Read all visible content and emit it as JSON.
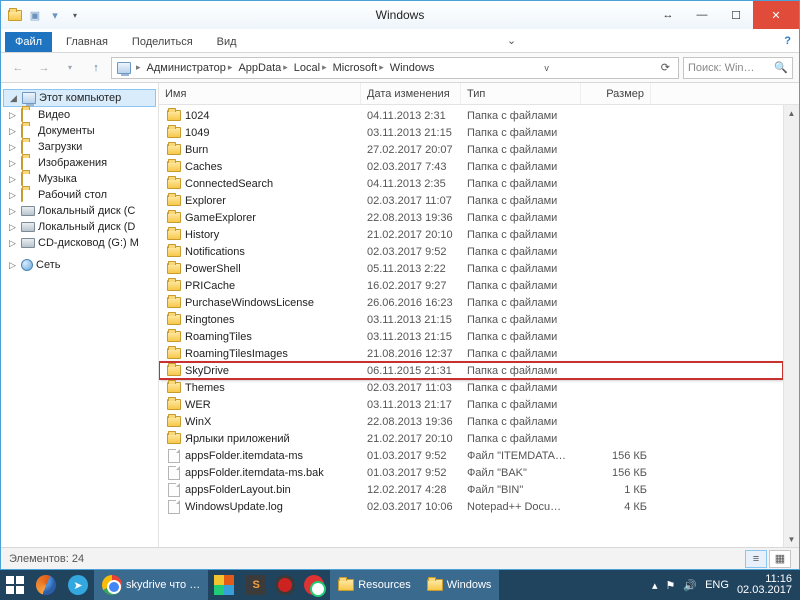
{
  "title": "Windows",
  "ribbon": {
    "file": "Файл",
    "home": "Главная",
    "share": "Поделиться",
    "view": "Вид"
  },
  "breadcrumb": [
    "Администратор",
    "AppData",
    "Local",
    "Microsoft",
    "Windows"
  ],
  "search": {
    "placeholder": "Поиск: Win…"
  },
  "columns": {
    "name": "Имя",
    "date": "Дата изменения",
    "type": "Тип",
    "size": "Размер"
  },
  "nav": {
    "root": "Этот компьютер",
    "items": [
      "Видео",
      "Документы",
      "Загрузки",
      "Изображения",
      "Музыка",
      "Рабочий стол",
      "Локальный диск (C",
      "Локальный диск (D",
      "CD-дисковод (G:) M"
    ],
    "network": "Сеть"
  },
  "folder_type": "Папка с файлами",
  "entries": [
    {
      "icon": "folder",
      "name": "1024",
      "date": "04.11.2013 2:31",
      "type": "Папка с файлами",
      "size": ""
    },
    {
      "icon": "folder",
      "name": "1049",
      "date": "03.11.2013 21:15",
      "type": "Папка с файлами",
      "size": ""
    },
    {
      "icon": "folder",
      "name": "Burn",
      "date": "27.02.2017 20:07",
      "type": "Папка с файлами",
      "size": ""
    },
    {
      "icon": "folder",
      "name": "Caches",
      "date": "02.03.2017 7:43",
      "type": "Папка с файлами",
      "size": ""
    },
    {
      "icon": "folder",
      "name": "ConnectedSearch",
      "date": "04.11.2013 2:35",
      "type": "Папка с файлами",
      "size": ""
    },
    {
      "icon": "folder",
      "name": "Explorer",
      "date": "02.03.2017 11:07",
      "type": "Папка с файлами",
      "size": ""
    },
    {
      "icon": "folder",
      "name": "GameExplorer",
      "date": "22.08.2013 19:36",
      "type": "Папка с файлами",
      "size": ""
    },
    {
      "icon": "folder",
      "name": "History",
      "date": "21.02.2017 20:10",
      "type": "Папка с файлами",
      "size": ""
    },
    {
      "icon": "folder",
      "name": "Notifications",
      "date": "02.03.2017 9:52",
      "type": "Папка с файлами",
      "size": ""
    },
    {
      "icon": "folder",
      "name": "PowerShell",
      "date": "05.11.2013 2:22",
      "type": "Папка с файлами",
      "size": ""
    },
    {
      "icon": "folder",
      "name": "PRICache",
      "date": "16.02.2017 9:27",
      "type": "Папка с файлами",
      "size": ""
    },
    {
      "icon": "folder",
      "name": "PurchaseWindowsLicense",
      "date": "26.06.2016 16:23",
      "type": "Папка с файлами",
      "size": ""
    },
    {
      "icon": "folder",
      "name": "Ringtones",
      "date": "03.11.2013 21:15",
      "type": "Папка с файлами",
      "size": ""
    },
    {
      "icon": "folder",
      "name": "RoamingTiles",
      "date": "03.11.2013 21:15",
      "type": "Папка с файлами",
      "size": ""
    },
    {
      "icon": "folder",
      "name": "RoamingTilesImages",
      "date": "21.08.2016 12:37",
      "type": "Папка с файлами",
      "size": ""
    },
    {
      "icon": "folder",
      "name": "SkyDrive",
      "date": "06.11.2015 21:31",
      "type": "Папка с файлами",
      "size": "",
      "hl": true
    },
    {
      "icon": "folder",
      "name": "Themes",
      "date": "02.03.2017 11:03",
      "type": "Папка с файлами",
      "size": ""
    },
    {
      "icon": "folder",
      "name": "WER",
      "date": "03.11.2013 21:17",
      "type": "Папка с файлами",
      "size": ""
    },
    {
      "icon": "folder",
      "name": "WinX",
      "date": "22.08.2013 19:36",
      "type": "Папка с файлами",
      "size": ""
    },
    {
      "icon": "folder",
      "name": "Ярлыки приложений",
      "date": "21.02.2017 20:10",
      "type": "Папка с файлами",
      "size": ""
    },
    {
      "icon": "file",
      "name": "appsFolder.itemdata-ms",
      "date": "01.03.2017 9:52",
      "type": "Файл \"ITEMDATA…",
      "size": "156 КБ"
    },
    {
      "icon": "file",
      "name": "appsFolder.itemdata-ms.bak",
      "date": "01.03.2017 9:52",
      "type": "Файл \"BAK\"",
      "size": "156 КБ"
    },
    {
      "icon": "file",
      "name": "appsFolderLayout.bin",
      "date": "12.02.2017 4:28",
      "type": "Файл \"BIN\"",
      "size": "1 КБ"
    },
    {
      "icon": "file",
      "name": "WindowsUpdate.log",
      "date": "02.03.2017 10:06",
      "type": "Notepad++ Docu…",
      "size": "4 КБ"
    }
  ],
  "status": {
    "count_label": "Элементов: 24"
  },
  "taskbar": {
    "chrome_task": "skydrive что …",
    "resources": "Resources",
    "windows": "Windows",
    "lang": "ENG",
    "time": "11:16",
    "date": "02.03.2017"
  }
}
